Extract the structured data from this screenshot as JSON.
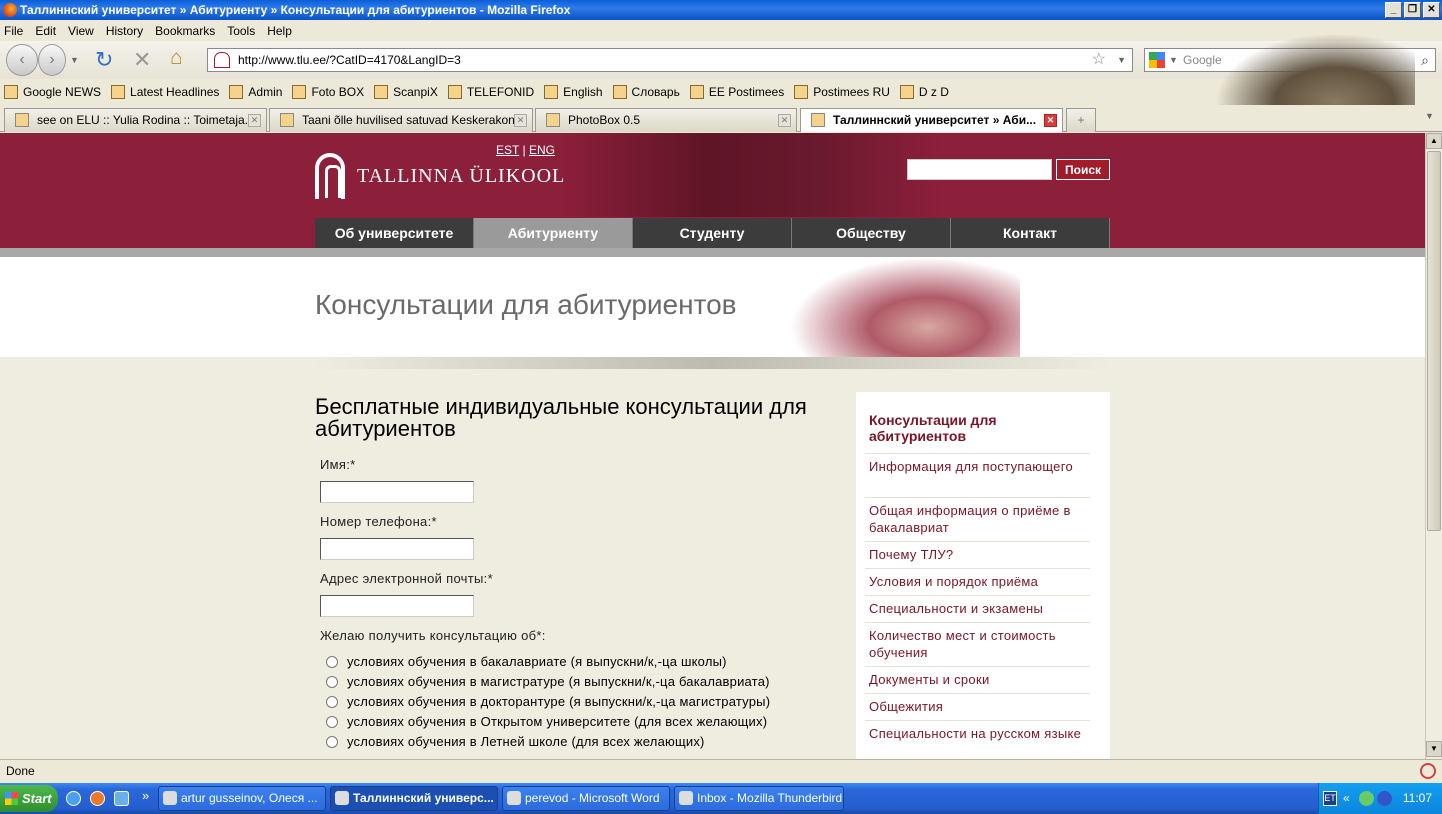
{
  "window": {
    "title": "Таллиннский университет » Абитуриенту » Консультации для абитуриентов - Mozilla Firefox",
    "buttons": [
      "_",
      "❐",
      "✕"
    ]
  },
  "menu": [
    "File",
    "Edit",
    "View",
    "History",
    "Bookmarks",
    "Tools",
    "Help"
  ],
  "nav": {
    "url": "http://www.tlu.ee/?CatID=4170&LangID=3",
    "search_placeholder": "Google"
  },
  "bookmarks": [
    "Google NEWS",
    "Latest Headlines",
    "Admin",
    "Foto BOX",
    "ScanpiX",
    "TELEFONID",
    "English",
    "Словарь",
    "EE Postimees",
    "Postimees RU",
    "D z D"
  ],
  "tabs": [
    {
      "label": "see on ELU :: Yulia Rodina :: Toimetaja..."
    },
    {
      "label": "Taani õlle huvilised satuvad Keskerakon..."
    },
    {
      "label": "PhotoBox 0.5"
    },
    {
      "label": "Таллиннский университет » Аби..."
    }
  ],
  "site": {
    "logo": "TALLINNA ÜLIKOOL",
    "lang_est": "EST",
    "lang_sep": "|",
    "lang_eng": "ENG",
    "search_button": "Поиск",
    "nav": [
      "Об университете",
      "Абитуриенту",
      "Студенту",
      "Обществу",
      "Контакт"
    ],
    "banner_title": "Консультации для абитуриентов",
    "heading": "Бесплатные индивидуальные консультации для абитуриентов",
    "form": {
      "name_label": "Имя:*",
      "phone_label": "Номер телефона:*",
      "email_label": "Адрес электронной почты:*",
      "consult_label": "Желаю получить консультацию об*:",
      "options": [
        "условиях обучения в бакалавриате (я выпускни/к,-ца школы)",
        "условиях обучения в магистратуре (я выпускни/к,-ца бакалавриата)",
        "условиях обучения в докторантуре (я выпускни/к,-ца магистратуры)",
        "условиях обучения в Открытом университете (для всех желающих)",
        "условиях обучения в Летней школе (для всех желающих)"
      ]
    },
    "sidebar": {
      "heading": "Консультации для абитуриентов",
      "items": [
        "Информация для поступающего",
        "Общая информация о приёме в бакалавриат",
        "Почему ТЛУ?",
        "Условия и порядок приёма",
        "Специальности и экзамены",
        "Количество мест и стоимость обучения",
        "Документы и сроки",
        "Общежития",
        "Специальности на русском языке"
      ]
    }
  },
  "status": "Done",
  "taskbar": {
    "start": "Start",
    "tasks": [
      "artur gusseinov, Олеся ...",
      "Таллиннский универс...",
      "perevod - Microsoft Word",
      "Inbox - Mozilla Thunderbird"
    ],
    "lang": "ET",
    "clock": "11:07"
  }
}
